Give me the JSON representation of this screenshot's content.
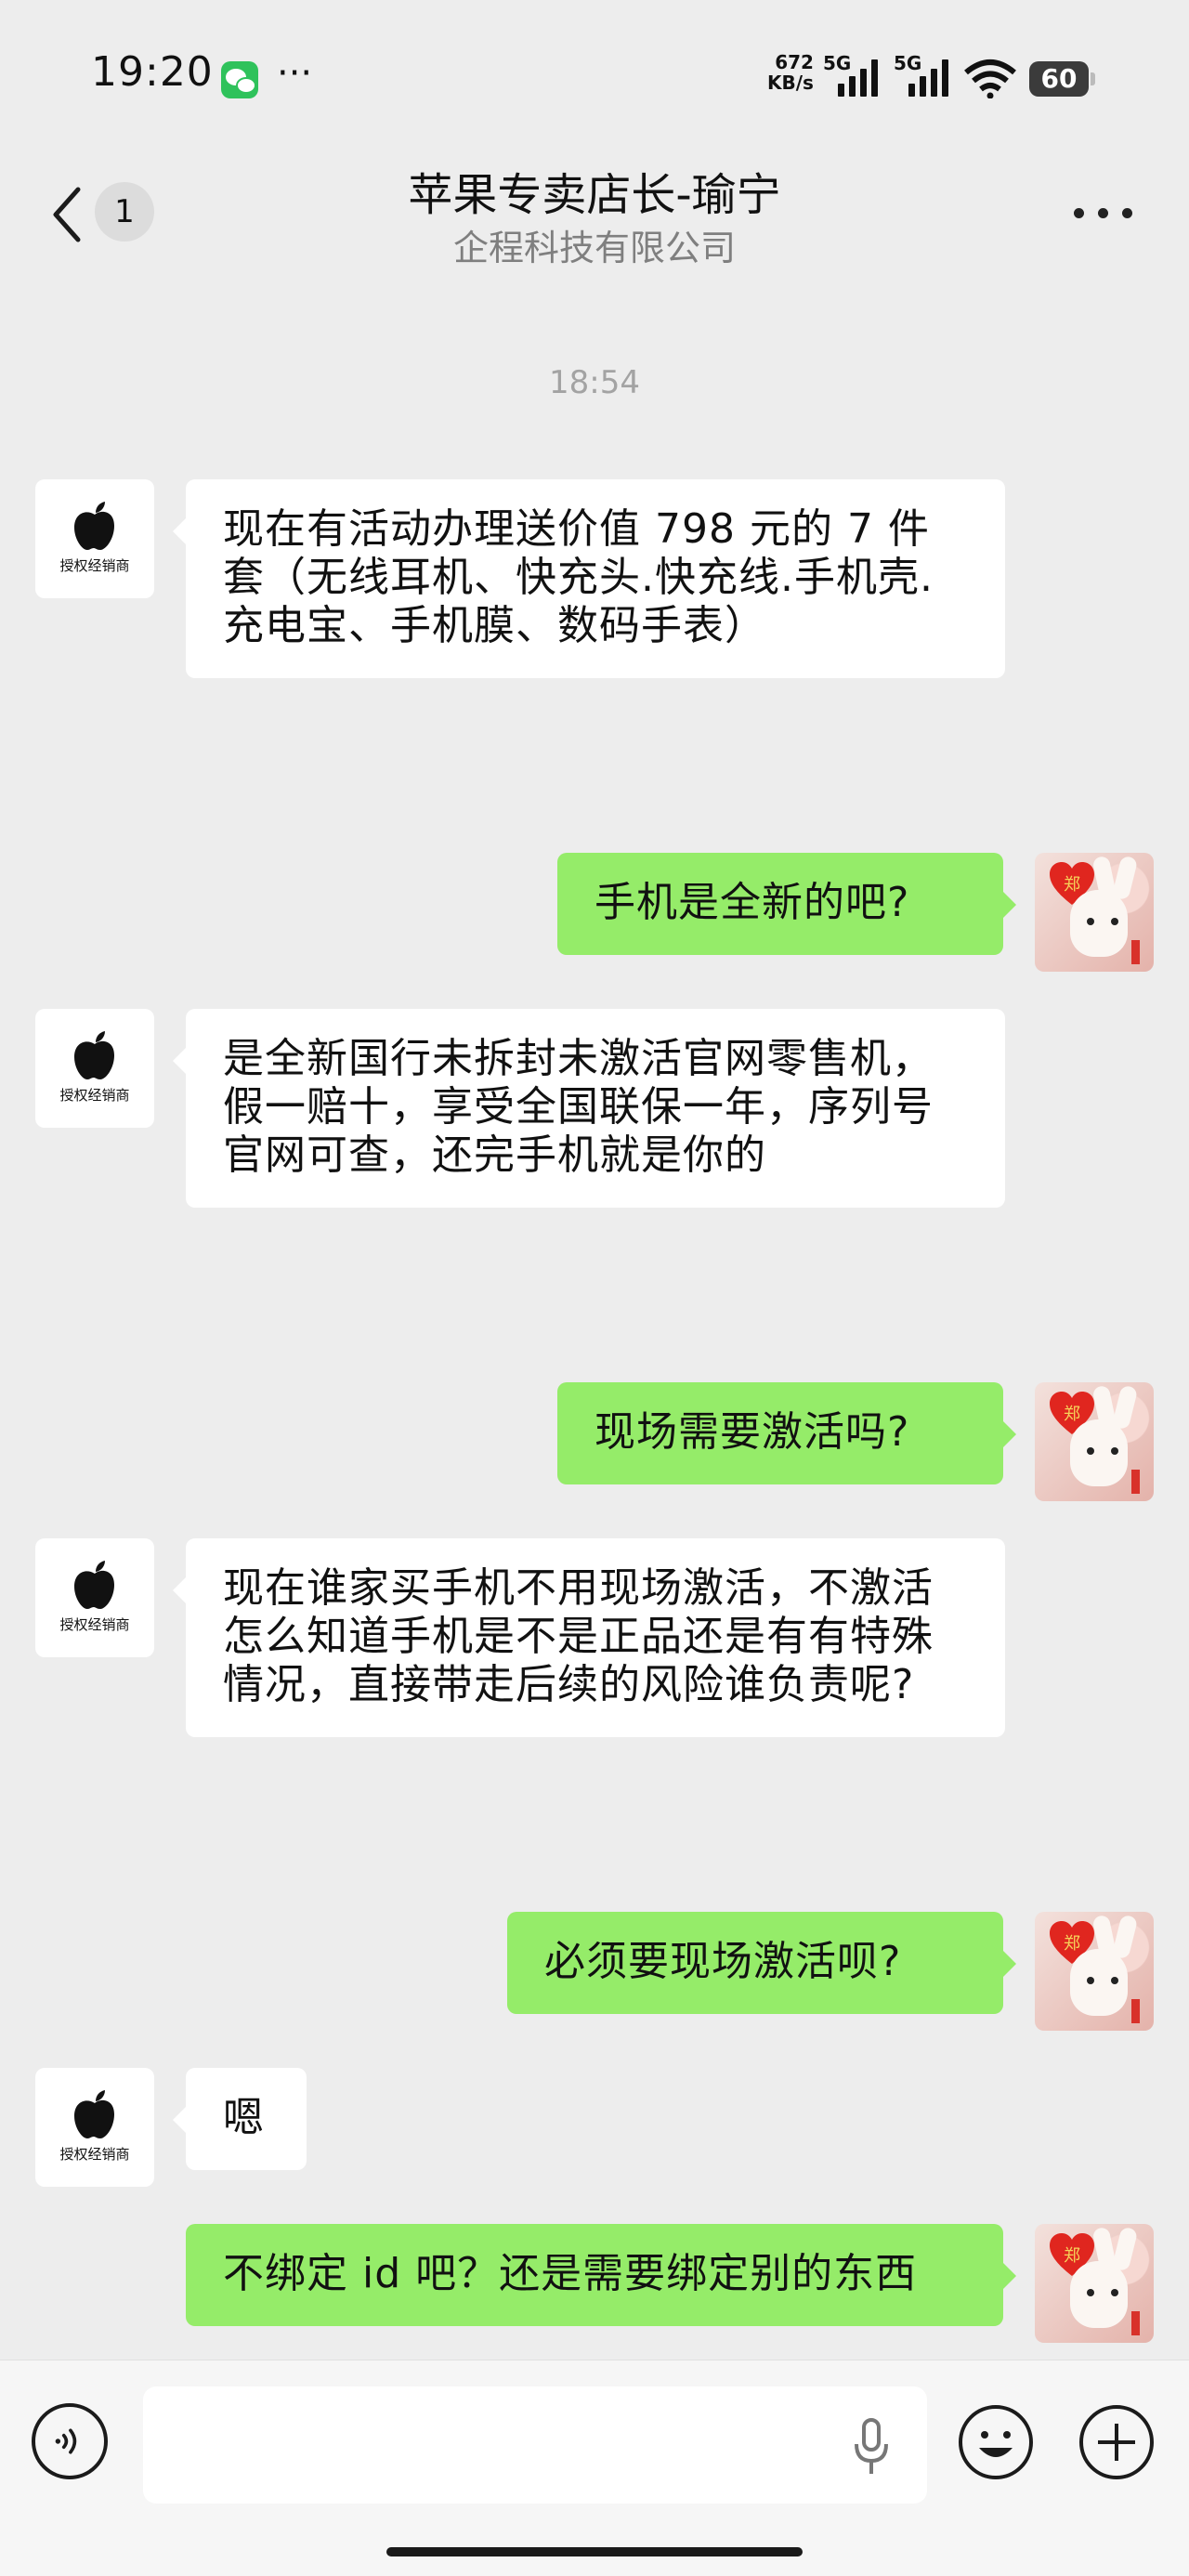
{
  "status_bar": {
    "time": "19:20",
    "more": "···",
    "net_speed_value": "672",
    "net_speed_unit": "KB/s",
    "signal1_label": "5G",
    "signal2_label": "5G",
    "battery": "60"
  },
  "header": {
    "unread_count": "1",
    "title": "苹果专卖店长-瑜宁",
    "subtitle": "企程科技有限公司"
  },
  "chat": {
    "timestamp": "18:54",
    "contact_avatar_caption": "授权经销商",
    "messages": [
      {
        "side": "left",
        "text": "现在有活动办理送价值 798 元的 7 件套（无线耳机、快充头.快充线.手机壳.充电宝、手机膜、数码手表）"
      },
      {
        "side": "right",
        "text": "手机是全新的吧?"
      },
      {
        "side": "left",
        "text": "是全新国行未拆封未激活官网零售机，假一赔十，享受全国联保一年，序列号官网可查，还完手机就是你的"
      },
      {
        "side": "right",
        "text": "现场需要激活吗?"
      },
      {
        "side": "left",
        "text": "现在谁家买手机不用现场激活，不激活怎么知道手机是不是正品还是有有特殊情况，直接带走后续的风险谁负责呢?"
      },
      {
        "side": "right",
        "text": "必须要现场激活呗?"
      },
      {
        "side": "left",
        "text": "嗯"
      },
      {
        "side": "right",
        "text": "不绑定 id 吧？还是需要绑定别的东西"
      }
    ]
  },
  "input_bar": {
    "placeholder": ""
  },
  "colors": {
    "accent_green": "#95ec69",
    "background": "#ededed"
  },
  "icons": {
    "voice": "voice-icon",
    "mic": "microphone-icon",
    "emoji": "emoji-icon",
    "plus": "plus-icon",
    "back": "back-arrow-icon",
    "more": "more-icon"
  }
}
